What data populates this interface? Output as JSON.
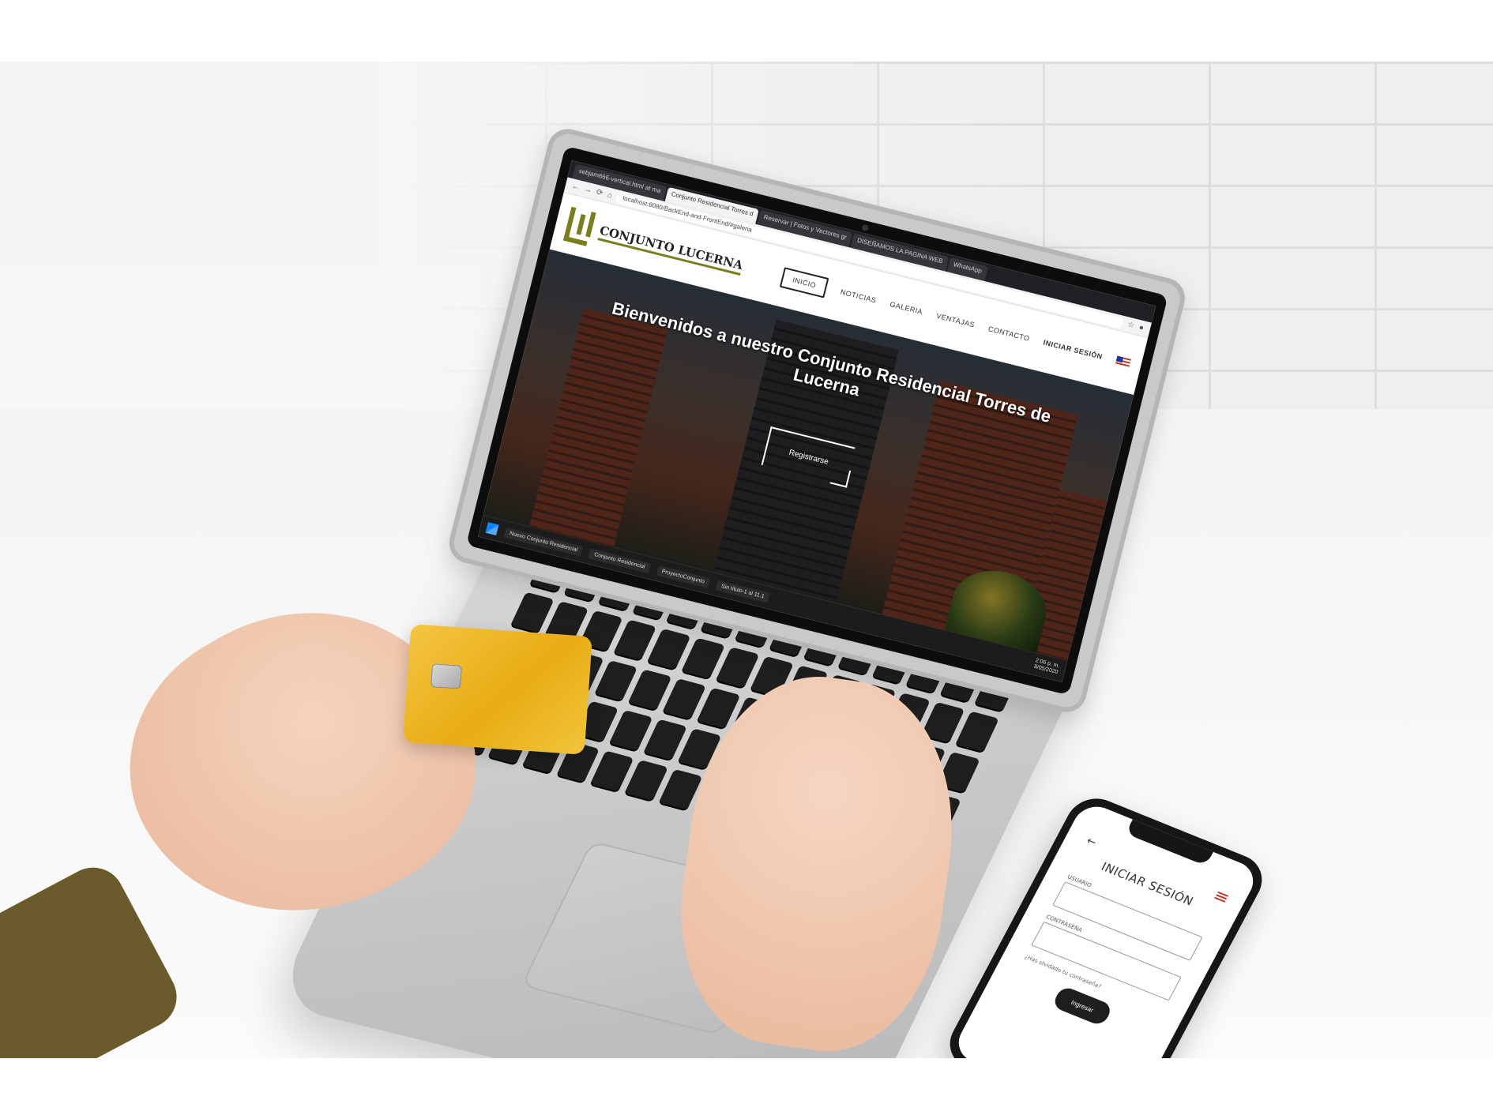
{
  "browser": {
    "tabs": [
      {
        "label": "sebjam666-vertical.html at ma",
        "active": false
      },
      {
        "label": "Conjunto Residencial Torres d",
        "active": true
      },
      {
        "label": "Reservar | Fotos y Vectores gr",
        "active": false
      },
      {
        "label": "DISEÑAMOS LA PAGINA WEB",
        "active": false
      },
      {
        "label": "WhatsApp",
        "active": false
      }
    ],
    "url": "localhost:8080/BackEnd-and-FrontEnd/#galeria"
  },
  "site": {
    "brand": "CONJUNTO LUCERNA",
    "nav": [
      {
        "label": "INICIO",
        "active": true
      },
      {
        "label": "NOTICIAS",
        "active": false
      },
      {
        "label": "GALERIA",
        "active": false
      },
      {
        "label": "VENTAJAS",
        "active": false
      },
      {
        "label": "CONTACTO",
        "active": false
      },
      {
        "label": "INICIAR SESIÓN",
        "active": false
      }
    ],
    "hero_title": "Bienvenidos a nuestro Conjunto Residencial Torres de Lucerna",
    "hero_cta": "Registrarse",
    "flag_icon": "us-flag-icon"
  },
  "taskbar": {
    "items": [
      "Nuevo Conjunto Residencial",
      "Conjunto Residencial",
      "ProyectoConjunto",
      "Sin título-1 al 11.1"
    ],
    "time": "2:06 p. m.",
    "date": "8/05/2020"
  },
  "phone": {
    "title": "INICIAR SESIÓN",
    "user_label": "USUARIO",
    "password_label": "CONTRASEÑA",
    "forgot_text": "¿Has olvidado tu contraseña?",
    "submit_label": "Ingresar"
  },
  "colors": {
    "brand_olive": "#7a7e1e",
    "card_gold": "#e8ac14",
    "dark": "#1e1e1e"
  }
}
